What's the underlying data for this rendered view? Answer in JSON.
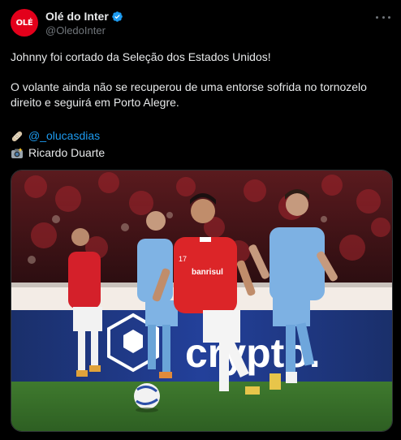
{
  "account": {
    "display_name": "Olé do Inter",
    "handle": "@OledoInter",
    "avatar_text": "OLÉ",
    "verified": true
  },
  "tweet": {
    "line1": "Johnny foi cortado da Seleção dos Estados Unidos!",
    "line2": "O volante ainda não se recuperou de uma entorse sofrida no tornozelo direito e seguirá em Porto Alegre.",
    "credit_handle": "@_olucasdias",
    "credit_photo": "Ricardo Duarte"
  },
  "media": {
    "board_text": "crypto.",
    "sponsor_text": "banrisul",
    "shirt_number": "17"
  },
  "colors": {
    "background": "#000000",
    "text": "#e7e9ea",
    "secondary": "#71767b",
    "link": "#1d9bf0",
    "brand_red": "#e3001b"
  },
  "icons": [
    "verified-badge-icon",
    "more-options-icon",
    "bandage-emoji-icon",
    "camera-emoji-icon"
  ]
}
